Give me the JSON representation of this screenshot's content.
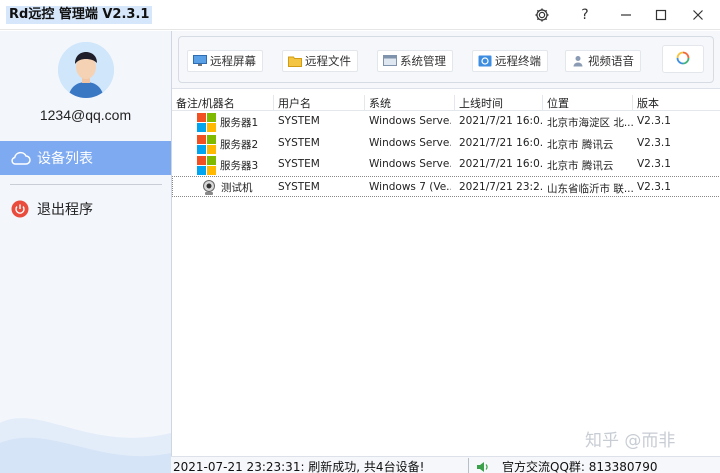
{
  "window": {
    "title": "Rd远控  管理端 V2.3.1",
    "settings_icon": "gear-icon",
    "help_label": "?",
    "minimize_icon": "minimize-icon",
    "maximize_icon": "maximize-icon",
    "close_icon": "close-icon"
  },
  "sidebar": {
    "email": "1234@qq.com",
    "items": [
      {
        "label": "设备列表",
        "icon": "cloud-icon",
        "active": true
      },
      {
        "label": "退出程序",
        "icon": "power-icon",
        "active": false
      }
    ]
  },
  "toolbar": {
    "buttons": [
      {
        "label": "远程屏幕",
        "icon": "monitor-icon"
      },
      {
        "label": "远程文件",
        "icon": "folder-icon"
      },
      {
        "label": "系统管理",
        "icon": "window-icon"
      },
      {
        "label": "远程终端",
        "icon": "terminal-icon"
      },
      {
        "label": "视频语音",
        "icon": "user-icon"
      }
    ],
    "refresh_icon": "refresh-icon"
  },
  "table": {
    "headers": [
      "备注/机器名",
      "用户名",
      "系统",
      "上线时间",
      "位置",
      "版本"
    ],
    "rows": [
      {
        "name": "服务器1",
        "user": "SYSTEM",
        "os": "Windows Serve...",
        "time": "2021/7/21 16:0...",
        "location": "北京市海淀区 北...",
        "version": "V2.3.1",
        "icon": "windows-logo-icon"
      },
      {
        "name": "服务器2",
        "user": "SYSTEM",
        "os": "Windows Serve...",
        "time": "2021/7/21 16:0...",
        "location": "北京市 腾讯云",
        "version": "V2.3.1",
        "icon": "windows-logo-icon"
      },
      {
        "name": "服务器3",
        "user": "SYSTEM",
        "os": "Windows Serve...",
        "time": "2021/7/21 16:0...",
        "location": "北京市 腾讯云",
        "version": "V2.3.1",
        "icon": "windows-logo-icon"
      },
      {
        "name": "测试机",
        "user": "SYSTEM",
        "os": "Windows 7 (Ve...",
        "time": "2021/7/21 23:2...",
        "location": "山东省临沂市 联...",
        "version": "V2.3.1",
        "icon": "webcam-icon",
        "selected": true
      }
    ]
  },
  "status": {
    "message": "2021-07-21 23:23:31: 刷新成功, 共4台设备!",
    "qq_group": "官方交流QQ群: 813380790",
    "speaker_icon": "speaker-icon"
  },
  "watermark": "知乎 @而非",
  "colors": {
    "accent": "#7eaaf1",
    "sidebar_bg": "#f3f6fb",
    "exit_red": "#e94b3c"
  }
}
